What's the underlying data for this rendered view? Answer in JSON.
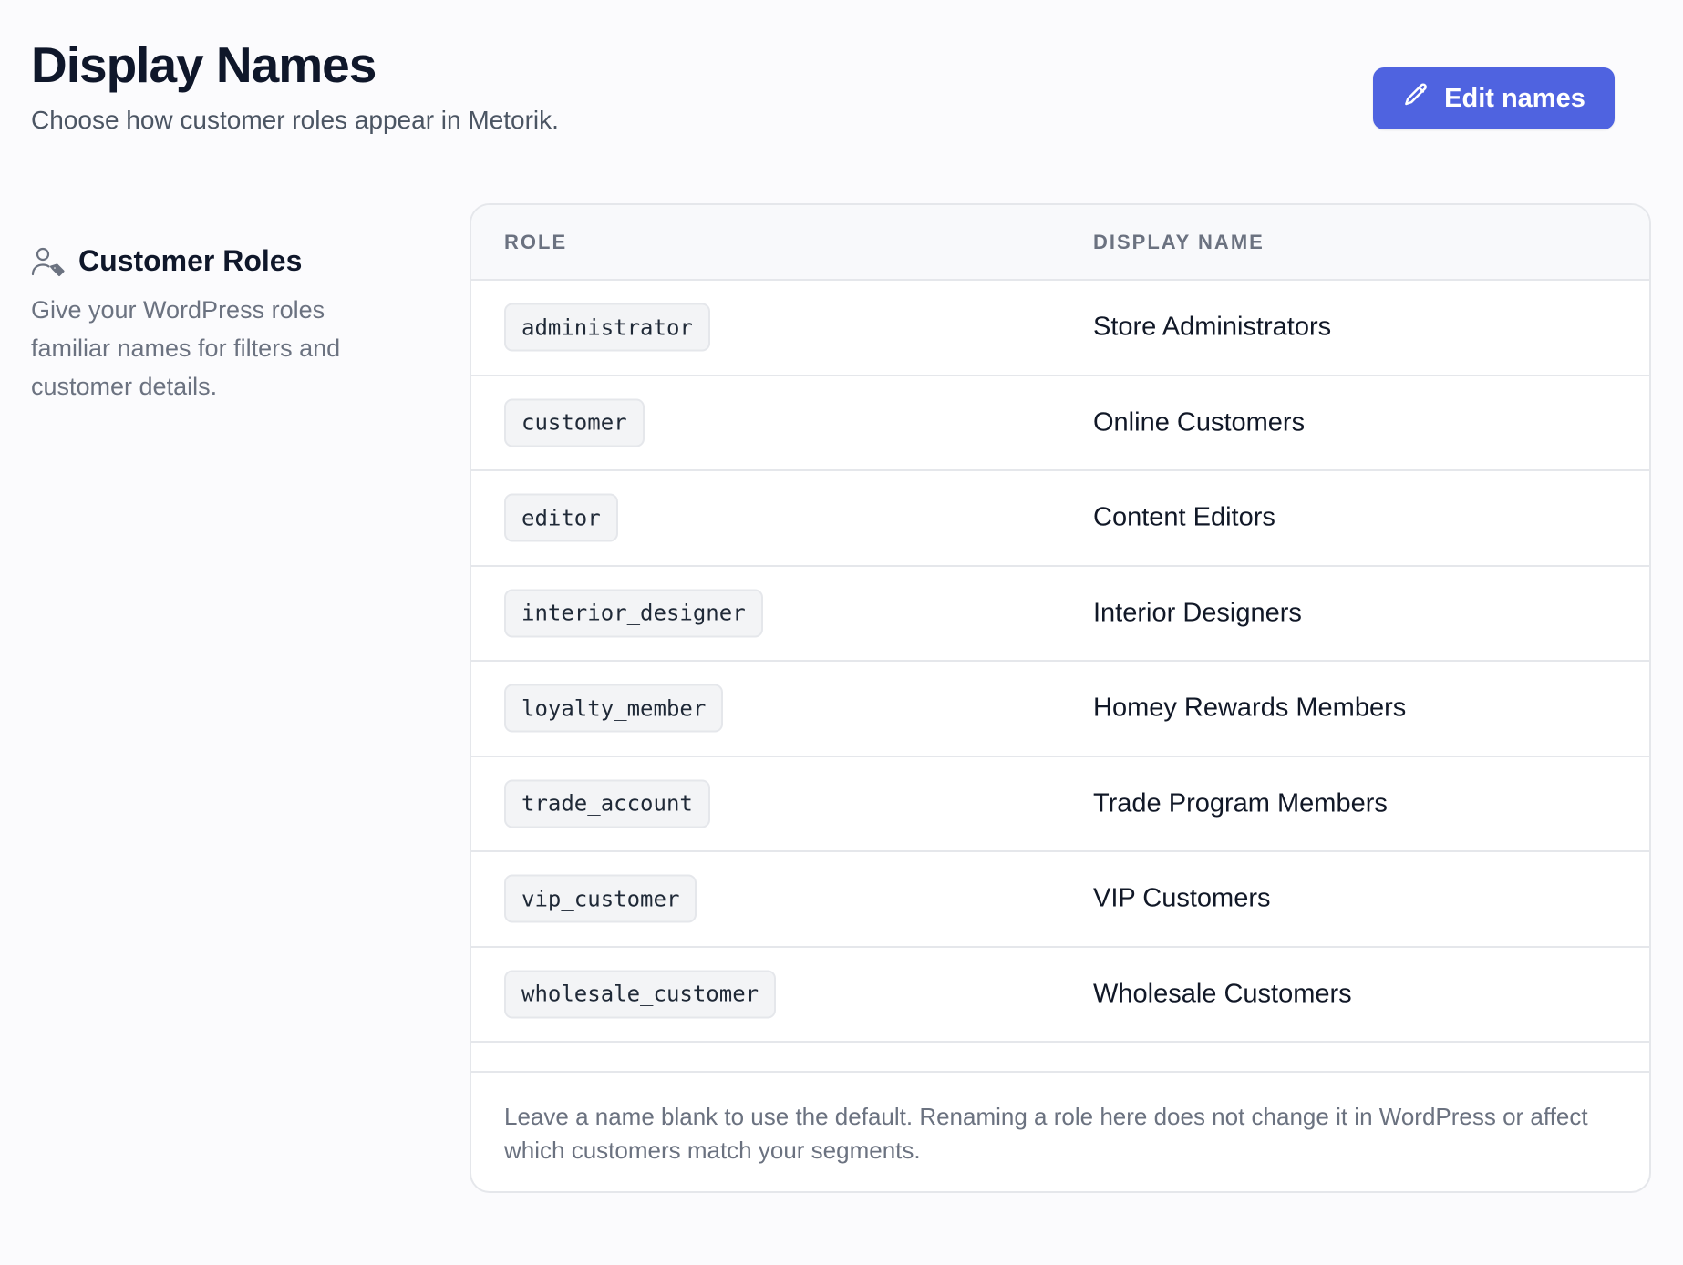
{
  "header": {
    "title": "Display Names",
    "subtitle": "Choose how customer roles appear in Metorik."
  },
  "actions": {
    "edit_label": "Edit names",
    "edit_icon": "pencil-icon",
    "accent_color": "#4f63e0"
  },
  "aside": {
    "icon": "user-tag-icon",
    "title": "Customer Roles",
    "description": "Give your WordPress roles familiar names for filters and customer details."
  },
  "table": {
    "columns": {
      "role": "ROLE",
      "display_name": "DISPLAY NAME"
    },
    "rows": [
      {
        "role": "administrator",
        "display_name": "Store Administrators"
      },
      {
        "role": "customer",
        "display_name": "Online Customers"
      },
      {
        "role": "editor",
        "display_name": "Content Editors"
      },
      {
        "role": "interior_designer",
        "display_name": "Interior Designers"
      },
      {
        "role": "loyalty_member",
        "display_name": "Homey Rewards Members"
      },
      {
        "role": "trade_account",
        "display_name": "Trade Program Members"
      },
      {
        "role": "vip_customer",
        "display_name": "VIP Customers"
      },
      {
        "role": "wholesale_customer",
        "display_name": "Wholesale Customers"
      }
    ],
    "footer_note": "Leave a name blank to use the default. Renaming a role here does not change it in WordPress or affect which customers match your segments."
  }
}
